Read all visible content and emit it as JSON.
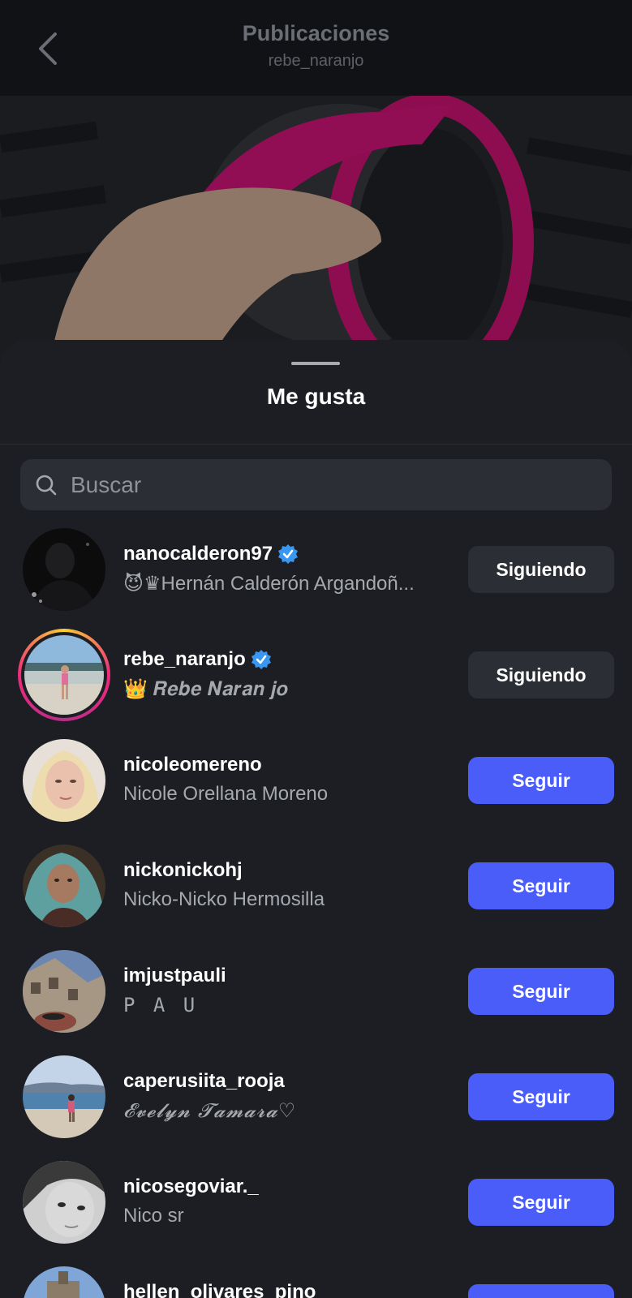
{
  "header": {
    "title": "Publicaciones",
    "subtitle": "rebe_naranjo"
  },
  "sheet": {
    "title": "Me gusta",
    "search_placeholder": "Buscar"
  },
  "users": [
    {
      "username": "nanocalderon97",
      "verified": true,
      "fullname": "😈♛Hernán Calderón Argandoñ...",
      "button": "Siguiendo",
      "following": true
    },
    {
      "username": "rebe_naranjo",
      "verified": true,
      "fullname": "👑 𝑹𝒆𝒃𝒆 𝑵𝒂𝒓𝒂𝒏 𝒋𝒐",
      "button": "Siguiendo",
      "following": true,
      "story_ring": true
    },
    {
      "username": "nicoleomereno",
      "verified": false,
      "fullname": "Nicole Orellana Moreno",
      "button": "Seguir",
      "following": false
    },
    {
      "username": "nickonickohj",
      "verified": false,
      "fullname": "Nicko-Nicko Hermosilla",
      "button": "Seguir",
      "following": false
    },
    {
      "username": "imjustpauli",
      "verified": false,
      "fullname": "P A U",
      "button": "Seguir",
      "following": false
    },
    {
      "username": "caperusiita_rooja",
      "verified": false,
      "fullname": "𝓔𝓿𝓮𝓵𝔂𝓷 𝓣𝓪𝓶𝓪𝓻𝓪♡",
      "button": "Seguir",
      "following": false
    },
    {
      "username": "nicosegoviar._",
      "verified": false,
      "fullname": "Nico sr",
      "button": "Seguir",
      "following": false
    },
    {
      "username": "hellen_olivares_pino",
      "verified": false,
      "fullname": "",
      "button": "Seguir",
      "following": false
    }
  ],
  "colors": {
    "follow_button": "#4a5df9",
    "following_button": "#2b2e35",
    "verified": "#3897f0"
  }
}
